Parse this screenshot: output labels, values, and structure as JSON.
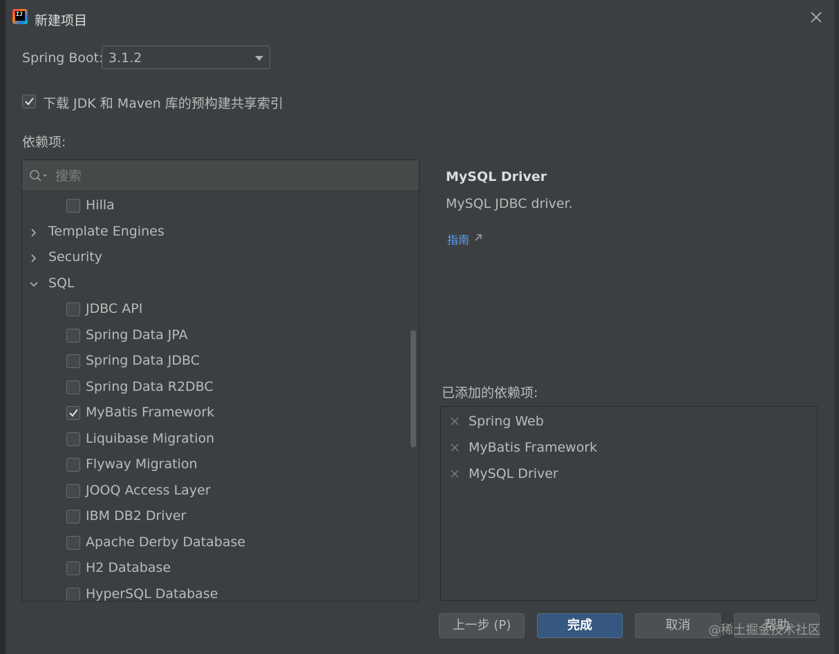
{
  "window": {
    "title": "新建项目"
  },
  "spring_boot": {
    "label": "Spring Boot:",
    "version": "3.1.2"
  },
  "jdk_option": {
    "label": "下载 JDK 和 Maven 库的预构建共享索引",
    "checked": true
  },
  "dependencies": {
    "label": "依赖项:",
    "search_placeholder": "搜索",
    "rows": [
      {
        "type": "item",
        "label": "Hilla",
        "checked": false
      },
      {
        "type": "group",
        "label": "Template Engines",
        "expanded": false
      },
      {
        "type": "group",
        "label": "Security",
        "expanded": false
      },
      {
        "type": "group",
        "label": "SQL",
        "expanded": true
      },
      {
        "type": "item",
        "label": "JDBC API",
        "checked": false
      },
      {
        "type": "item",
        "label": "Spring Data JPA",
        "checked": false
      },
      {
        "type": "item",
        "label": "Spring Data JDBC",
        "checked": false
      },
      {
        "type": "item",
        "label": "Spring Data R2DBC",
        "checked": false
      },
      {
        "type": "item",
        "label": "MyBatis Framework",
        "checked": true
      },
      {
        "type": "item",
        "label": "Liquibase Migration",
        "checked": false
      },
      {
        "type": "item",
        "label": "Flyway Migration",
        "checked": false
      },
      {
        "type": "item",
        "label": "JOOQ Access Layer",
        "checked": false
      },
      {
        "type": "item",
        "label": "IBM DB2 Driver",
        "checked": false
      },
      {
        "type": "item",
        "label": "Apache Derby Database",
        "checked": false
      },
      {
        "type": "item",
        "label": "H2 Database",
        "checked": false
      },
      {
        "type": "item",
        "label": "HyperSQL Database",
        "checked": false
      }
    ]
  },
  "details": {
    "title": "MySQL Driver",
    "description": "MySQL JDBC driver.",
    "guide_link": "指南"
  },
  "added": {
    "label": "已添加的依赖项:",
    "items": [
      "Spring Web",
      "MyBatis Framework",
      "MySQL Driver"
    ]
  },
  "buttons": {
    "previous": "上一步 (P)",
    "finish": "完成",
    "cancel": "取消",
    "help": "帮助"
  },
  "watermark": "@稀土掘金技术社区",
  "colors": {
    "background": "#3c3f41",
    "primary_button": "#365880",
    "link": "#589df6"
  }
}
